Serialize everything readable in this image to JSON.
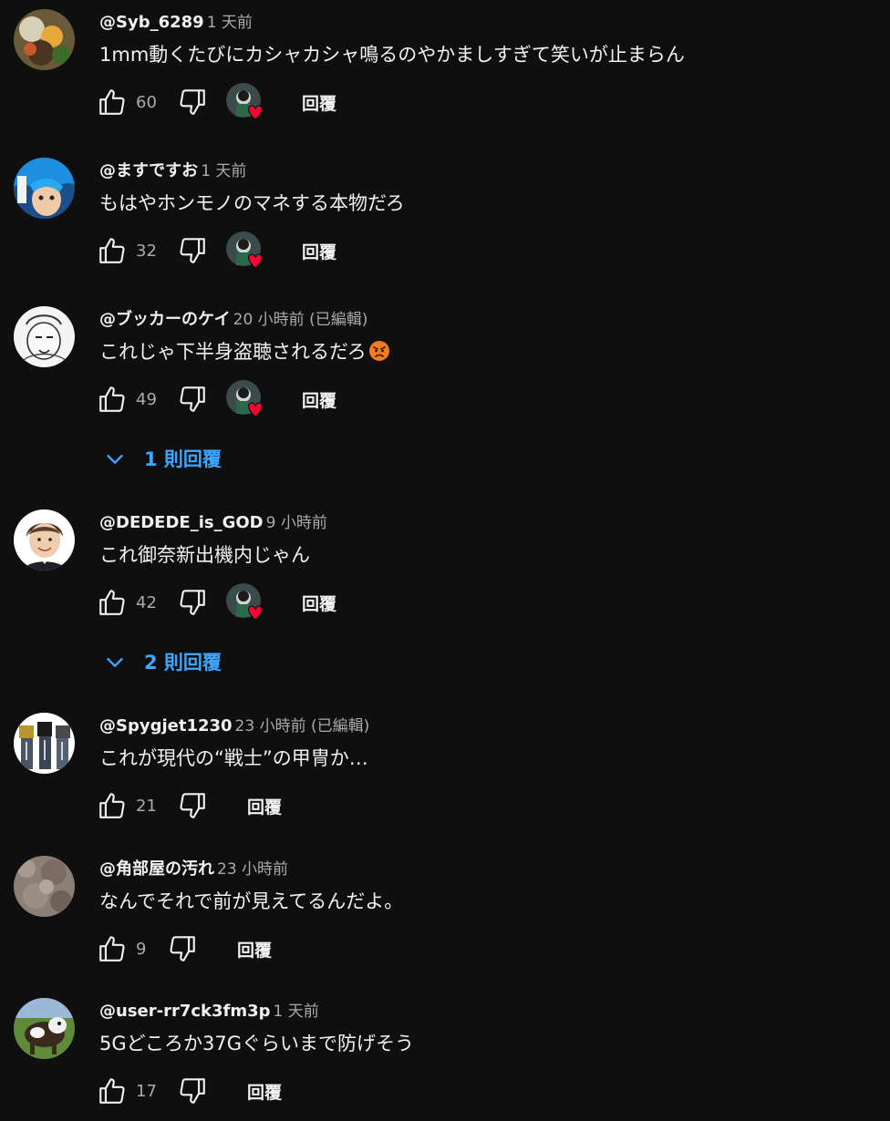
{
  "comments": [
    {
      "author": "@Syb_6289",
      "time": "1 天前",
      "text": "1mm動くたびにカシャカシャ鳴るのやかましすぎて笑いが止まらん",
      "likes": "60",
      "reply_label": "回覆",
      "creator_heart": true
    },
    {
      "author": "@ますですお",
      "time": "1 天前",
      "text": "もはやホンモノのマネする本物だろ",
      "likes": "32",
      "reply_label": "回覆",
      "creator_heart": true
    },
    {
      "author": "@ブッカーのケイ",
      "time": "20 小時前 (已編輯)",
      "text": "これじゃ下半身盗聴されるだろ",
      "emoji": "angry-face-icon",
      "likes": "49",
      "reply_label": "回覆",
      "creator_heart": true,
      "replies_label": "1 則回覆"
    },
    {
      "author": "@DEDEDE_is_GOD",
      "time": "9 小時前",
      "text": "これ御奈新出機内じゃん",
      "likes": "42",
      "reply_label": "回覆",
      "creator_heart": true,
      "replies_label": "2 則回覆"
    },
    {
      "author": "@Spygjet1230",
      "time": "23 小時前 (已編輯)",
      "text": "これが現代の“戦士”の甲冑か…",
      "likes": "21",
      "reply_label": "回覆",
      "creator_heart": false
    },
    {
      "author": "@角部屋の汚れ",
      "time": "23 小時前",
      "text": "なんでそれで前が見えてるんだよ。",
      "likes": "9",
      "reply_label": "回覆",
      "creator_heart": false
    },
    {
      "author": "@user-rr7ck3fm3p",
      "time": "1 天前",
      "text": "5Gどころか37Gぐらいまで防げそう",
      "likes": "17",
      "reply_label": "回覆",
      "creator_heart": false
    }
  ],
  "colors": {
    "background": "#0f0f0f",
    "text": "#f1f1f1",
    "secondary": "#aaaaaa",
    "link": "#3ea6ff",
    "heart": "#ff0033"
  }
}
